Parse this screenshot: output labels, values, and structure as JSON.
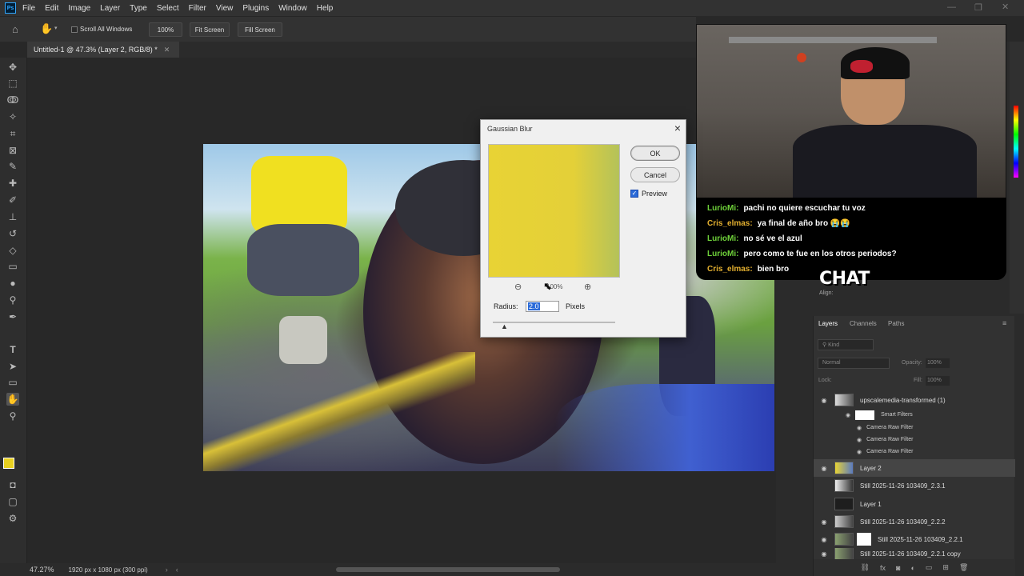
{
  "app": {
    "logo": "Ps"
  },
  "menu": [
    "File",
    "Edit",
    "Image",
    "Layer",
    "Type",
    "Select",
    "Filter",
    "View",
    "Plugins",
    "Window",
    "Help"
  ],
  "options": {
    "scroll_all": "Scroll All Windows",
    "zoom": "100%",
    "fit_screen": "Fit Screen",
    "fill_screen": "Fill Screen"
  },
  "document": {
    "tab_title": "Untitled-1 @ 47.3% (Layer 2, RGB/8) *"
  },
  "status": {
    "zoom": "47.27%",
    "size": "1920 px x 1080 px (300 ppi)"
  },
  "dialog": {
    "title": "Gaussian Blur",
    "ok": "OK",
    "cancel": "Cancel",
    "preview_label": "Preview",
    "preview_checked": true,
    "preview_zoom": "100%",
    "radius_label": "Radius:",
    "radius_value": "2.0",
    "radius_unit": "Pixels",
    "preview_color": "#e8d335"
  },
  "properties": {
    "align_label": "Align:"
  },
  "layers_panel": {
    "tabs": [
      "Layers",
      "Channels",
      "Paths"
    ],
    "filter_kind": "Kind",
    "blend_mode": "Normal",
    "opacity_label": "Opacity:",
    "opacity_value": "100%",
    "lock_label": "Lock:",
    "fill_label": "Fill:",
    "fill_value": "100%",
    "layers": [
      {
        "name": "upscalemedia-transformed (1)",
        "visible": true
      },
      {
        "name": "Smart Filters"
      },
      {
        "name": "Camera Raw Filter"
      },
      {
        "name": "Camera Raw Filter"
      },
      {
        "name": "Camera Raw Filter"
      },
      {
        "name": "Layer 2",
        "visible": true,
        "selected": true
      },
      {
        "name": "Still 2025-11-26 103409_2.3.1",
        "visible": false
      },
      {
        "name": "Layer 1",
        "visible": false
      },
      {
        "name": "Still 2025-11-26 103409_2.2.2",
        "visible": true
      },
      {
        "name": "Still 2025-11-26 103409_2.2.1",
        "visible": true
      },
      {
        "name": "Still 2025-11-26 103409_2.2.1 copy",
        "visible": true
      }
    ]
  },
  "overlay": {
    "chat_title": "CHAT",
    "messages": [
      {
        "user": "LurioMi:",
        "text": "pachi no quiere escuchar tu voz"
      },
      {
        "user": "Cris_elmas:",
        "text": "ya final de año bro 😭😭"
      },
      {
        "user": "LurioMi:",
        "text": "no sé ve el azul"
      },
      {
        "user": "LurioMi:",
        "text": "pero como te fue en los otros periodos?"
      },
      {
        "user": "Cris_elmas:",
        "text": "bien bro"
      }
    ]
  },
  "colors": {
    "foreground": "#e8d020",
    "background": "#1030d0"
  }
}
